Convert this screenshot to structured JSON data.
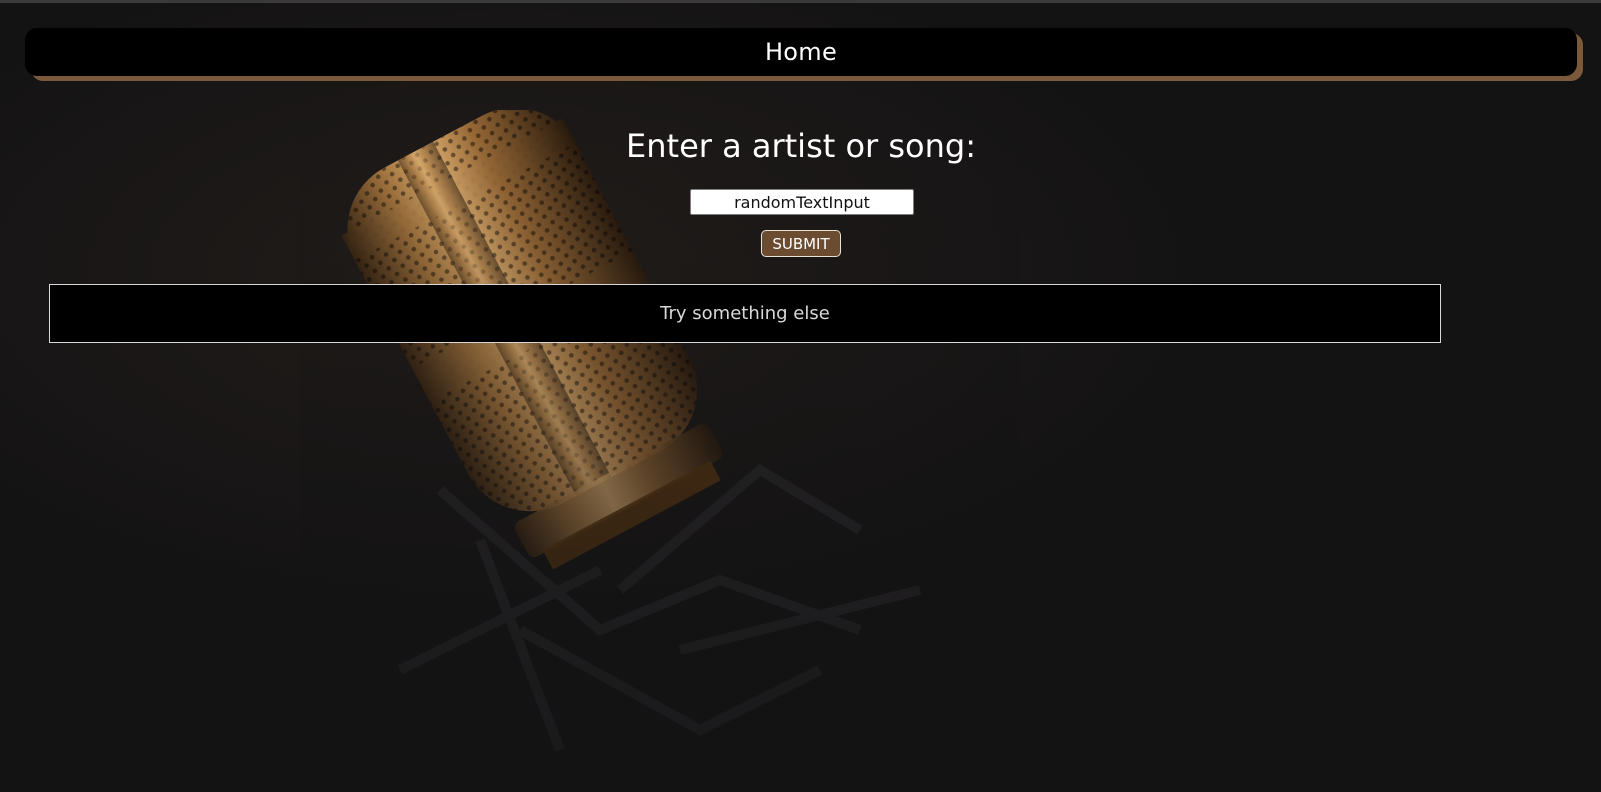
{
  "nav": {
    "home_label": "Home"
  },
  "search": {
    "heading": "Enter a artist or song:",
    "input_value": "randomTextInput",
    "submit_label": "SUBMIT"
  },
  "results": {
    "message": "Try something else"
  },
  "colors": {
    "background": "#141314",
    "nav_background": "#000000",
    "nav_shadow": "#7b5a3c",
    "button_background": "#6b4c31",
    "result_background": "#000000"
  },
  "icons": {
    "background_image": "microphone-icon"
  }
}
